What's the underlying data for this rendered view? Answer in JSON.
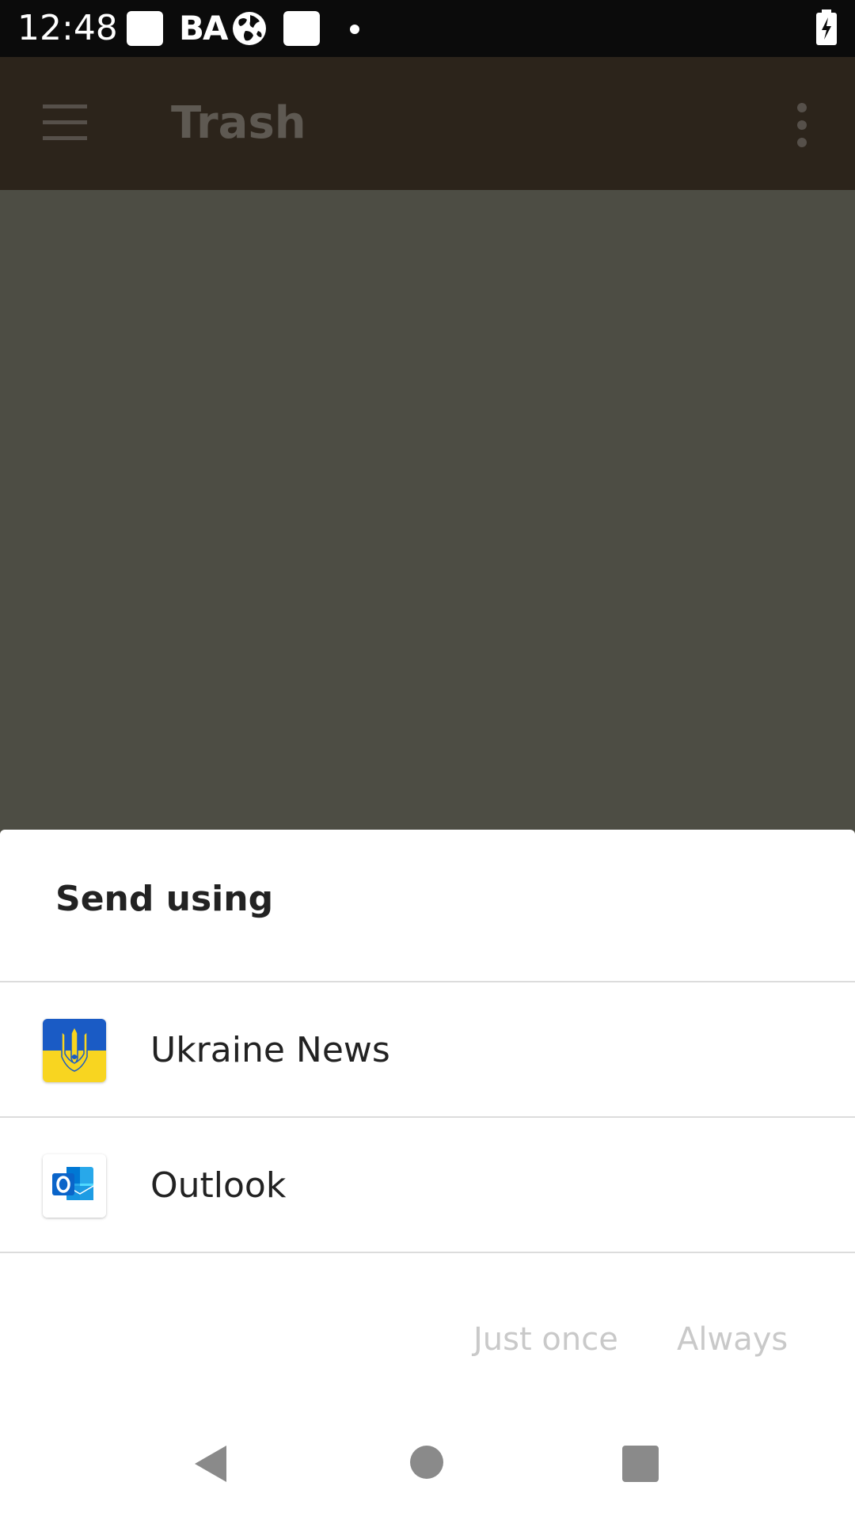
{
  "status_bar": {
    "time": "12:48",
    "carrier_text": "BA",
    "icons": [
      "notification-square-icon",
      "globe-icon",
      "notification-square-icon",
      "dot-icon",
      "battery-charging-icon"
    ]
  },
  "app_bar": {
    "title": "Trash",
    "menu_icon": "hamburger-menu-icon",
    "overflow_icon": "more-vert-icon"
  },
  "dialog": {
    "title": "Send using",
    "apps": [
      {
        "label": "Ukraine News",
        "icon": "ukraine-news-icon"
      },
      {
        "label": "Outlook",
        "icon": "outlook-icon"
      }
    ],
    "buttons": {
      "just_once": "Just once",
      "always": "Always"
    }
  },
  "colors": {
    "scrim": "#4d4d44",
    "app_bar": "#2c241b",
    "status_bar": "#0b0b0b",
    "disabled_button": "#c9c9c9",
    "flag_blue": "#1a5bc5",
    "flag_yellow": "#f8d520",
    "outlook_blue": "#0a64c9"
  },
  "nav_bar": {
    "icons": [
      "back-icon",
      "home-icon",
      "recents-icon"
    ]
  }
}
